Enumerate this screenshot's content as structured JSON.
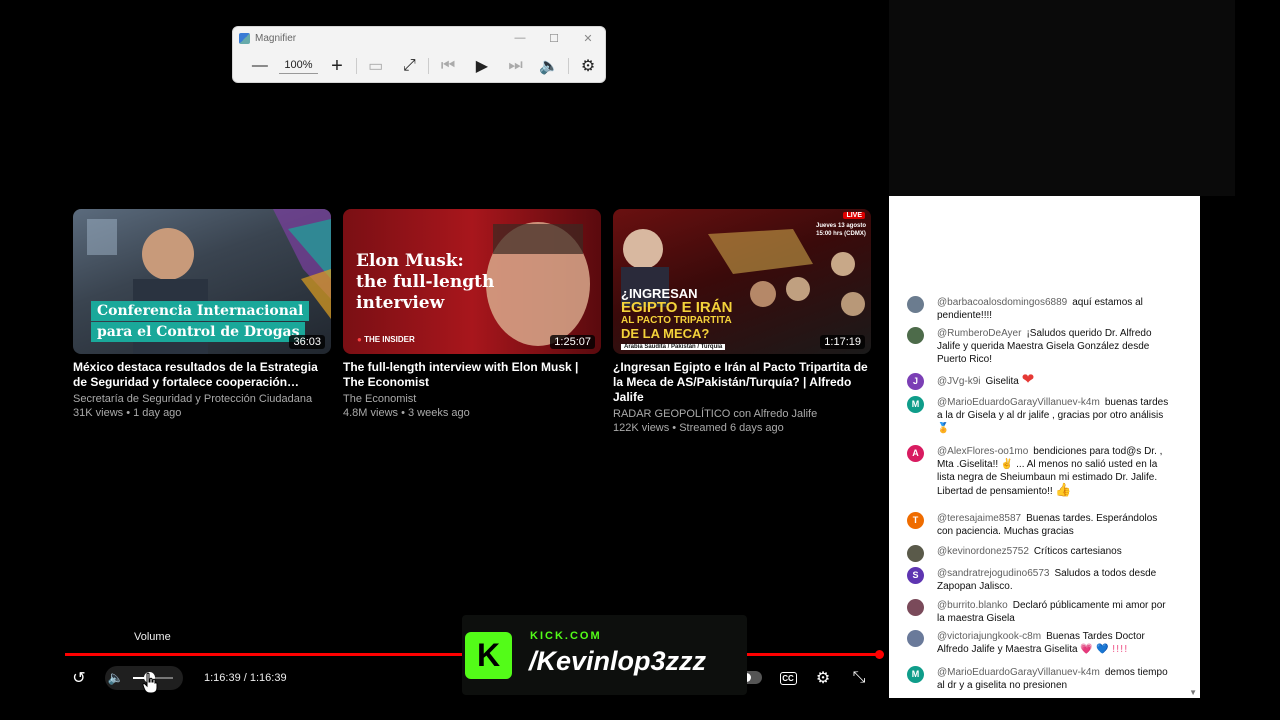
{
  "magnifier": {
    "title": "Magnifier",
    "zoom": "100%",
    "zoom_out_icon": "minus-icon",
    "zoom_in_icon": "plus-icon"
  },
  "videos": [
    {
      "thumb_text": "Conferencia Internacional para el Control de Drogas",
      "thumb_line1": "Conferencia Internacional",
      "thumb_line2": "para el Control de Drogas",
      "duration": "36:03",
      "title": "México destaca resultados de la Estrategia de Seguridad y fortalece cooperación…",
      "channel": "Secretaría de Seguridad y Protección Ciudadana",
      "stats": "31K views • 1 day ago"
    },
    {
      "thumb_line1": "Elon Musk:",
      "thumb_line2": "the full-length",
      "thumb_line3": "interview",
      "thumb_brand": "THE INSIDER",
      "duration": "1:25:07",
      "title": "The full-length interview with Elon Musk | The Economist",
      "channel": "The Economist",
      "stats": "4.8M views • 3 weeks ago"
    },
    {
      "thumb_line1": "¿INGRESAN",
      "thumb_line2": "EGIPTO E IRÁN",
      "thumb_line3": "AL PACTO TRIPARTITA",
      "thumb_line4": "DE LA MECA?",
      "thumb_sub": "Arabia Saudita / Pakistán / Turquía",
      "thumb_live": "LIVE",
      "thumb_date": "Jueves 13 agosto 15:00 hrs (CDMX)",
      "duration": "1:17:19",
      "title": "¿Ingresan Egipto e Irán al Pacto Tripartita de la Meca de AS/Pakistán/Turquía? | Alfredo Jalife",
      "channel": "RADAR GEOPOLÍTICO con Alfredo Jalife",
      "stats": "122K views • Streamed 6 days ago"
    }
  ],
  "chat": {
    "messages": [
      {
        "author": "@barbacoalosdomingos6889",
        "text": "aquí estamos al pendiente!!!!",
        "avatar": "",
        "color": "#6b7c8f"
      },
      {
        "author": "@RumberoDeAyer",
        "text": "¡Saludos querido Dr. Alfredo Jalife y querida Maestra Gisela González desde Puerto Rico!",
        "avatar": "",
        "color": "#4d6b4a"
      },
      {
        "author": "@JVg-k9i",
        "text": "Giselita",
        "emoji": "❤",
        "avatar": "J",
        "color": "#7b3fb5"
      },
      {
        "author": "@MarioEduardoGarayVillanuev-k4m",
        "text": "buenas tardes a la dr Gisela y al dr jalife , gracias por otro análisis",
        "emoji": "🏅",
        "avatar": "M",
        "color": "#0f9d8a"
      },
      {
        "author": "@AlexFlores-oo1mo",
        "text": "bendiciones para tod@s Dr. , Mta .Giselita!! ✌ ... Al menos no salió usted en la lista negra de Sheiumbaun mi estimado Dr. Jalife. Libertad de pensamiento!!",
        "emoji": "👍",
        "avatar": "A",
        "color": "#d81b60"
      },
      {
        "author": "@teresajaime8587",
        "text": "Buenas tardes. Esperándolos con paciencia. Muchas gracias",
        "avatar": "T",
        "color": "#ef6c00"
      },
      {
        "author": "@kevinordonez5752",
        "text": "Críticos cartesianos",
        "avatar": "",
        "color": "#5a5a4a"
      },
      {
        "author": "@sandratrejogudino6573",
        "text": "Saludos a todos desde Zapopan Jalisco.",
        "avatar": "S",
        "color": "#5e35b1"
      },
      {
        "author": "@burrito.blanko",
        "text": "Declaró públicamente mi amor por la maestra Gisela",
        "avatar": "",
        "color": "#7a4a5a"
      },
      {
        "author": "@victoriajungkook-c8m",
        "text": "Buenas Tardes Doctor Alfredo Jalife y Maestra Giselita",
        "emoji": "💗 💙 !!!!",
        "avatar": "",
        "color": "#6a7a9a"
      },
      {
        "author": "@MarioEduardoGarayVillanuev-k4m",
        "text": "demos tiempo al dr y a giselita no presionen",
        "avatar": "M",
        "color": "#0f9d8a"
      }
    ]
  },
  "player": {
    "tooltip": "Volume",
    "time": "1:16:39 / 1:16:39",
    "progress": 1.0,
    "volume": 0.4,
    "cc_label": "CC"
  },
  "overlay": {
    "site": "KICK.COM",
    "username": "/Kevinlop3zzz",
    "logo_letter": "K",
    "accent": "#53fc18"
  },
  "colors": {
    "progress": "#ff0000",
    "chat_bg": "#ffffff"
  }
}
